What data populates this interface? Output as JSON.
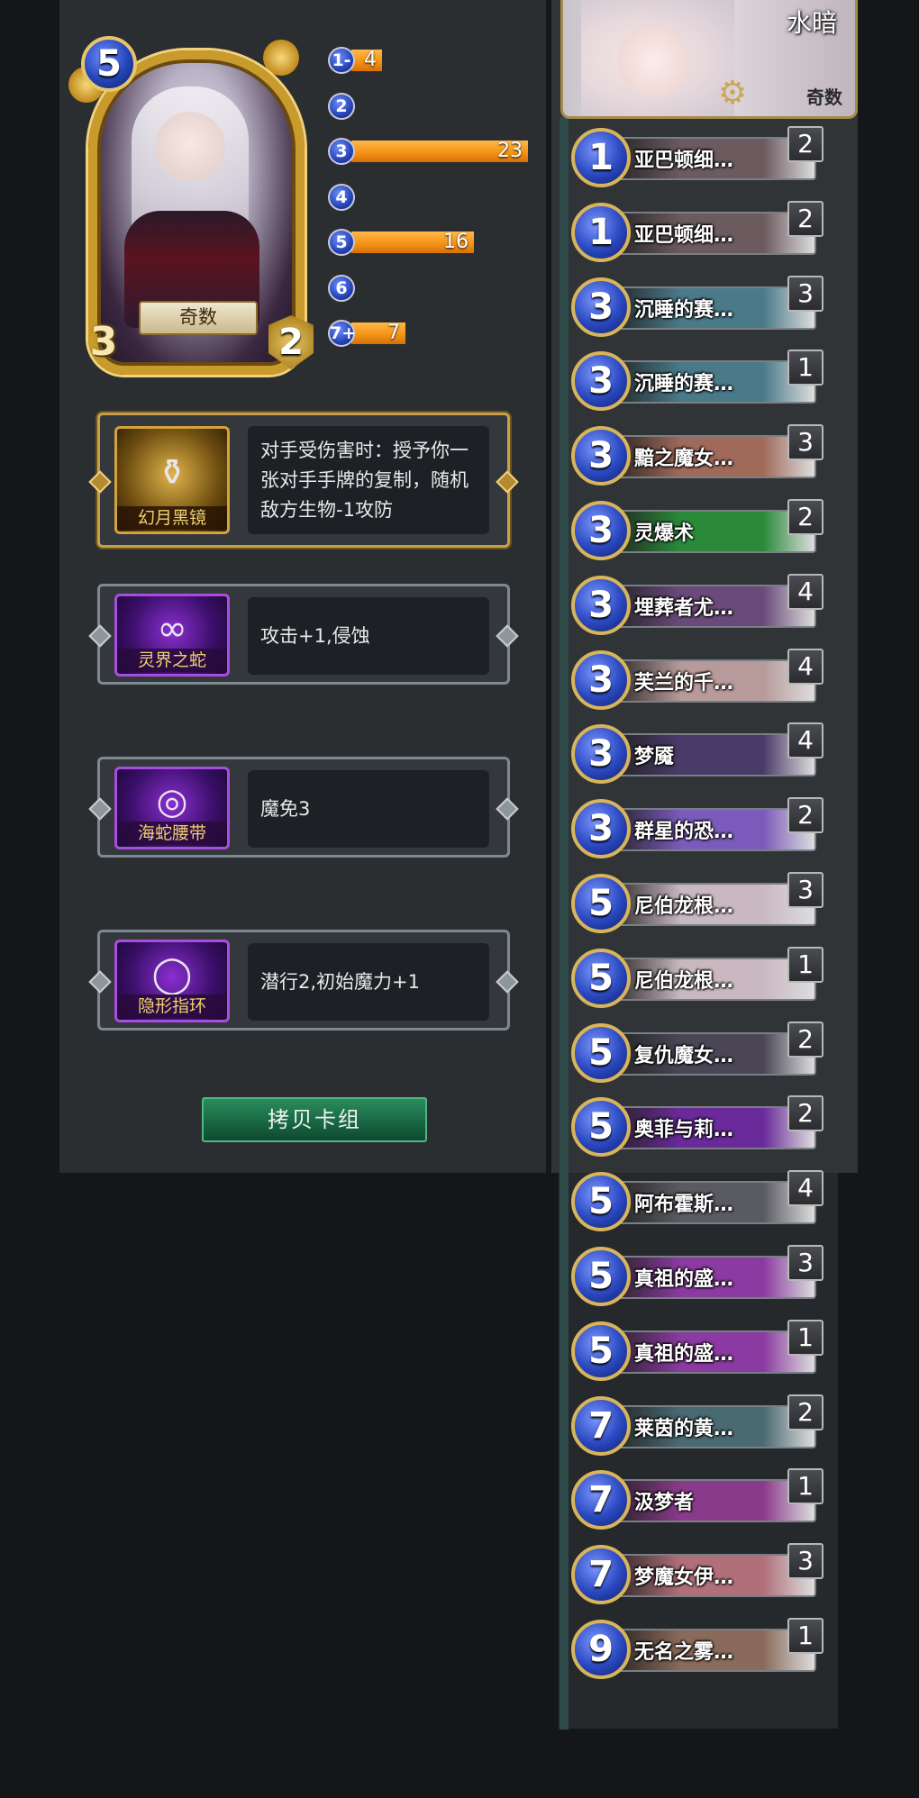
{
  "hero": {
    "name": "奇数",
    "cost": "5",
    "attack": "3",
    "health": "2"
  },
  "mana_curve": [
    {
      "label": "1-",
      "count": "4",
      "value": 4
    },
    {
      "label": "2",
      "count": "",
      "value": 0
    },
    {
      "label": "3",
      "count": "23",
      "value": 23
    },
    {
      "label": "4",
      "count": "",
      "value": 0
    },
    {
      "label": "5",
      "count": "16",
      "value": 16
    },
    {
      "label": "6",
      "count": "",
      "value": 0
    },
    {
      "label": "7+",
      "count": "7",
      "value": 7
    }
  ],
  "equipment": [
    {
      "name": "幻月黑镜",
      "description": "对手受伤害时：授予你一张对手手牌的复制，随机敌方生物-1攻防",
      "rarity": "gold"
    },
    {
      "name": "灵界之蛇",
      "description": "攻击+1,侵蚀",
      "rarity": "purple"
    },
    {
      "name": "海蛇腰带",
      "description": "魔免3",
      "rarity": "purple"
    },
    {
      "name": "隐形指环",
      "description": "潜行2,初始魔力+1",
      "rarity": "purple"
    }
  ],
  "copy_button": "拷贝卡组",
  "deck_header": {
    "title": "水暗",
    "class_label": "奇数"
  },
  "deck_list": [
    {
      "cost": "1",
      "name": "亚巴顿细…",
      "count": "2",
      "color": "#6b5a5e"
    },
    {
      "cost": "1",
      "name": "亚巴顿细…",
      "count": "2",
      "color": "#6b5a5e"
    },
    {
      "cost": "3",
      "name": "沉睡的赛…",
      "count": "3",
      "color": "#4a7a8a"
    },
    {
      "cost": "3",
      "name": "沉睡的赛…",
      "count": "1",
      "color": "#4a7a8a"
    },
    {
      "cost": "3",
      "name": "黯之魔女…",
      "count": "3",
      "color": "#a06a5a"
    },
    {
      "cost": "3",
      "name": "灵爆术",
      "count": "2",
      "color": "#2a8a3a"
    },
    {
      "cost": "3",
      "name": "埋葬者尤…",
      "count": "4",
      "color": "#6a4a7a"
    },
    {
      "cost": "3",
      "name": "芙兰的千…",
      "count": "4",
      "color": "#b79a9a"
    },
    {
      "cost": "3",
      "name": "梦魇",
      "count": "4",
      "color": "#4a3a6a"
    },
    {
      "cost": "3",
      "name": "群星的恐…",
      "count": "2",
      "color": "#7a5aba"
    },
    {
      "cost": "5",
      "name": "尼伯龙根…",
      "count": "3",
      "color": "#c9b8c0"
    },
    {
      "cost": "5",
      "name": "尼伯龙根…",
      "count": "1",
      "color": "#c9b8c0"
    },
    {
      "cost": "5",
      "name": "复仇魔女…",
      "count": "2",
      "color": "#4a4656"
    },
    {
      "cost": "5",
      "name": "奥菲与莉…",
      "count": "2",
      "color": "#6a2a9a"
    },
    {
      "cost": "5",
      "name": "阿布霍斯…",
      "count": "4",
      "color": "#5a5a62"
    },
    {
      "cost": "5",
      "name": "真祖的盛…",
      "count": "3",
      "color": "#8a3aa0"
    },
    {
      "cost": "5",
      "name": "真祖的盛…",
      "count": "1",
      "color": "#8a3aa0"
    },
    {
      "cost": "7",
      "name": "莱茵的黄…",
      "count": "2",
      "color": "#4a6a72"
    },
    {
      "cost": "7",
      "name": "汲梦者",
      "count": "1",
      "color": "#8a3a8a"
    },
    {
      "cost": "7",
      "name": "梦魔女伊…",
      "count": "3",
      "color": "#b0707a"
    },
    {
      "cost": "9",
      "name": "无名之雾…",
      "count": "1",
      "color": "#8a6a5a"
    }
  ]
}
